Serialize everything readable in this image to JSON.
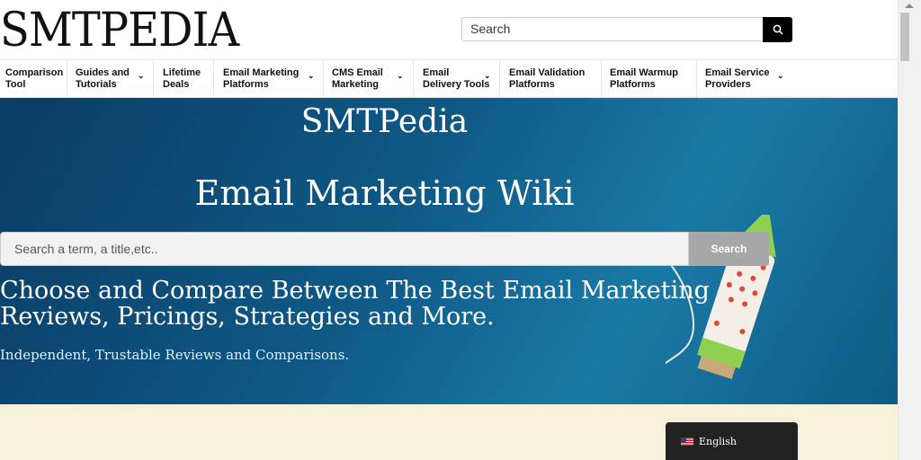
{
  "header": {
    "logo": "SMTPEDIA",
    "search_placeholder": "Search"
  },
  "nav": {
    "items": [
      {
        "line1": "Comparison",
        "line2": "Tool",
        "dropdown": false
      },
      {
        "line1": "Guides and",
        "line2": "Tutorials",
        "dropdown": true
      },
      {
        "line1": "Lifetime",
        "line2": "Deals",
        "dropdown": false
      },
      {
        "line1": "Email Marketing",
        "line2": "Platforms",
        "dropdown": true
      },
      {
        "line1": "CMS Email",
        "line2": "Marketing",
        "dropdown": true
      },
      {
        "line1": "Email",
        "line2": "Delivery Tools",
        "dropdown": true
      },
      {
        "line1": "Email Validation",
        "line2": "Platforms",
        "dropdown": false
      },
      {
        "line1": "Email Warmup",
        "line2": "Platforms",
        "dropdown": false
      },
      {
        "line1": "Email Service",
        "line2": "Providers",
        "dropdown": true
      }
    ]
  },
  "hero": {
    "title_line1": "SMTPedia",
    "title_line2": "Email Marketing Wiki",
    "search_placeholder": "Search a term, a title,etc..",
    "search_button": "Search",
    "heading_line1": "Choose and Compare Between The Best Email Marketing",
    "heading_line2": "Reviews, Pricings, Strategies and More.",
    "subtitle": "Independent, Trustable Reviews and Comparisons."
  },
  "language": {
    "label": "English",
    "flag_icon": "us-flag-icon"
  },
  "colors": {
    "hero_blue": "#0f5a88",
    "lower_bg": "#f6f1d8",
    "search_btn": "#000000"
  }
}
